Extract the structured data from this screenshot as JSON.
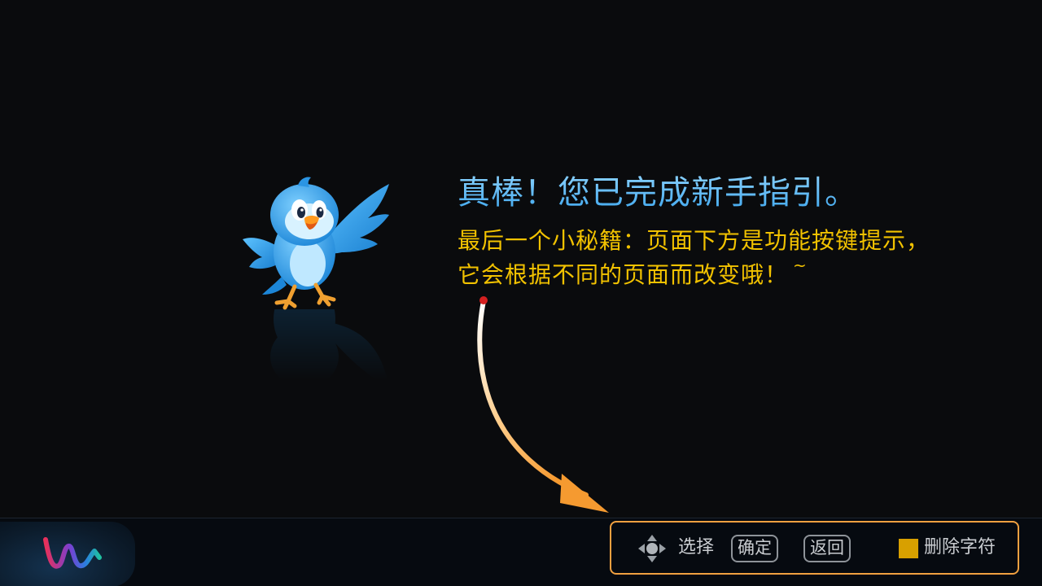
{
  "guide": {
    "headline": "真棒！您已完成新手指引。",
    "tip_line1": "最后一个小秘籍：页面下方是功能按键提示，",
    "tip_line2": "它会根据不同的页面而改变哦！",
    "tip_tilde": "~"
  },
  "footer": {
    "select_label": "选择",
    "ok_label": "确定",
    "back_label": "返回",
    "delete_label": "删除字符"
  },
  "colors": {
    "headline": "#4fb6f2",
    "tip": "#f2c200",
    "hint_border": "#f0a040",
    "delete_key": "#d8a000"
  },
  "icons": [
    "bird-mascot-icon",
    "brand-logo-icon",
    "dpad-icon",
    "curved-arrow-icon"
  ]
}
